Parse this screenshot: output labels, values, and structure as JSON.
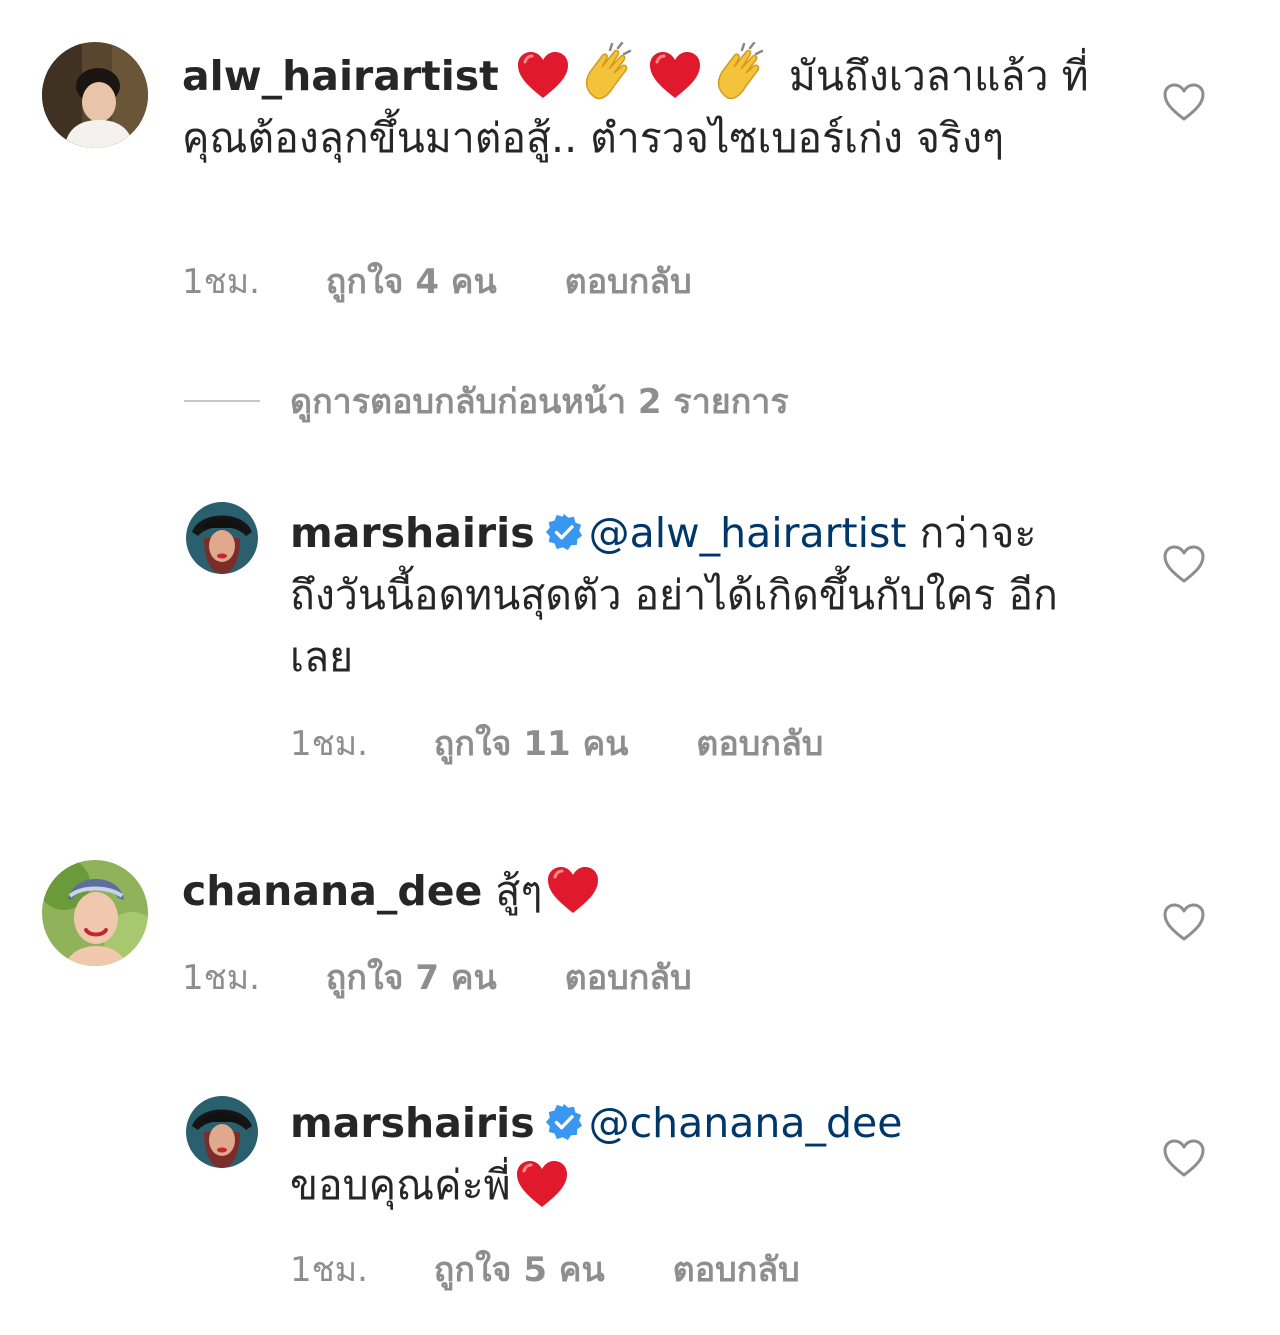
{
  "comments": [
    {
      "username": "alw_hairartist",
      "text_after_emojis": "มันถึงเวลาแล้ว",
      "text_rest": "ที่คุณต้องลุกขึ้นมาต่อสู้.. ตำรวจไซเบอร์เก่ง จริงๆ",
      "time": "1ชม.",
      "likes": "ถูกใจ 4 คน",
      "reply": "ตอบกลับ"
    },
    {
      "username": "marshairis",
      "mention": "@alw_hairartist",
      "text": "กว่าจะ ถึงวันนี้อดทนสุดตัว อย่าได้เกิดขึ้นกับใคร อีกเลย",
      "time": "1ชม.",
      "likes": "ถูกใจ 11 คน",
      "reply": "ตอบกลับ"
    },
    {
      "username": "chanana_dee",
      "text": "สู้ๆ",
      "time": "1ชม.",
      "likes": "ถูกใจ 7 คน",
      "reply": "ตอบกลับ"
    },
    {
      "username": "marshairis",
      "mention": "@chanana_dee",
      "text": "ขอบคุณค่ะพี่",
      "time": "1ชม.",
      "likes": "ถูกใจ 5 คน",
      "reply": "ตอบกลับ"
    }
  ],
  "view_replies_label": "ดูการตอบกลับก่อนหน้า 2 รายการ",
  "icons": {
    "like": "heart-outline-icon",
    "verified": "verified-badge-icon",
    "emoji_heart": "red-heart-emoji",
    "emoji_clap": "clapping-hands-emoji"
  },
  "colors": {
    "text": "#262626",
    "muted": "#8e8e8e",
    "mention": "#00376b",
    "verified": "#3897f0",
    "heart": "#e0192d"
  }
}
